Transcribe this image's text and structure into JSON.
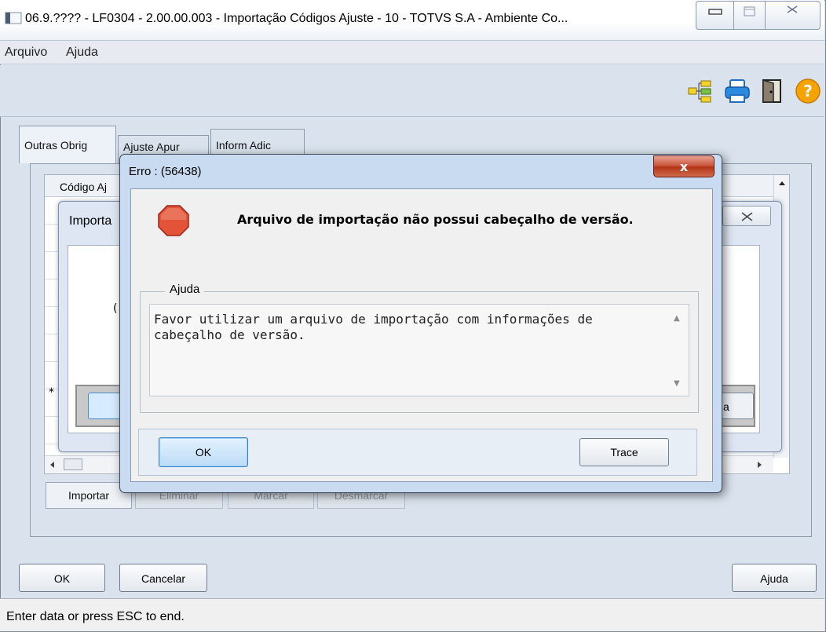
{
  "window": {
    "title": "06.9.???? - LF0304 - 2.00.00.003 - Importação Códigos Ajuste - 10 - TOTVS S.A - Ambiente Co..."
  },
  "menu": {
    "items": [
      "Arquivo",
      "Ajuda"
    ]
  },
  "toolbar": {
    "icons": [
      "tree-icon",
      "printer-icon",
      "exit-door-icon",
      "help-icon"
    ]
  },
  "tabs": [
    {
      "label": "Outras Obrig"
    },
    {
      "label": "Ajuste Apur"
    },
    {
      "label": "Inform Adic"
    }
  ],
  "grid": {
    "column_codigo": "Código Aj",
    "new_row_marker": "*",
    "buttons": {
      "importar": "Importar",
      "eliminar": "Eliminar",
      "marcar": "Marcar",
      "desmarcar": "Desmarcar"
    }
  },
  "import_dialog": {
    "title": "Importa",
    "partial_c": "(",
    "right_button_partial": "a"
  },
  "error_dialog": {
    "title": "Erro : (56438)",
    "close_glyph": "x",
    "message": "Arquivo de importação não possui cabeçalho de versão.",
    "help_legend": "Ajuda",
    "help_text": "Favor utilizar um arquivo de importação com informações de cabeçalho de versão.",
    "ok_label": "OK",
    "trace_label": "Trace"
  },
  "bottom": {
    "ok_label": "OK",
    "cancelar_label": "Cancelar",
    "ajuda_label": "Ajuda"
  },
  "status": {
    "text": "Enter data or press ESC to end."
  },
  "colors": {
    "window_bg": "#d9e2ed",
    "dialog_bg": "#c9dbf0",
    "close_red": "#c74e33",
    "stop_red": "#e2533a",
    "focus_blue": "#3a80c7"
  }
}
